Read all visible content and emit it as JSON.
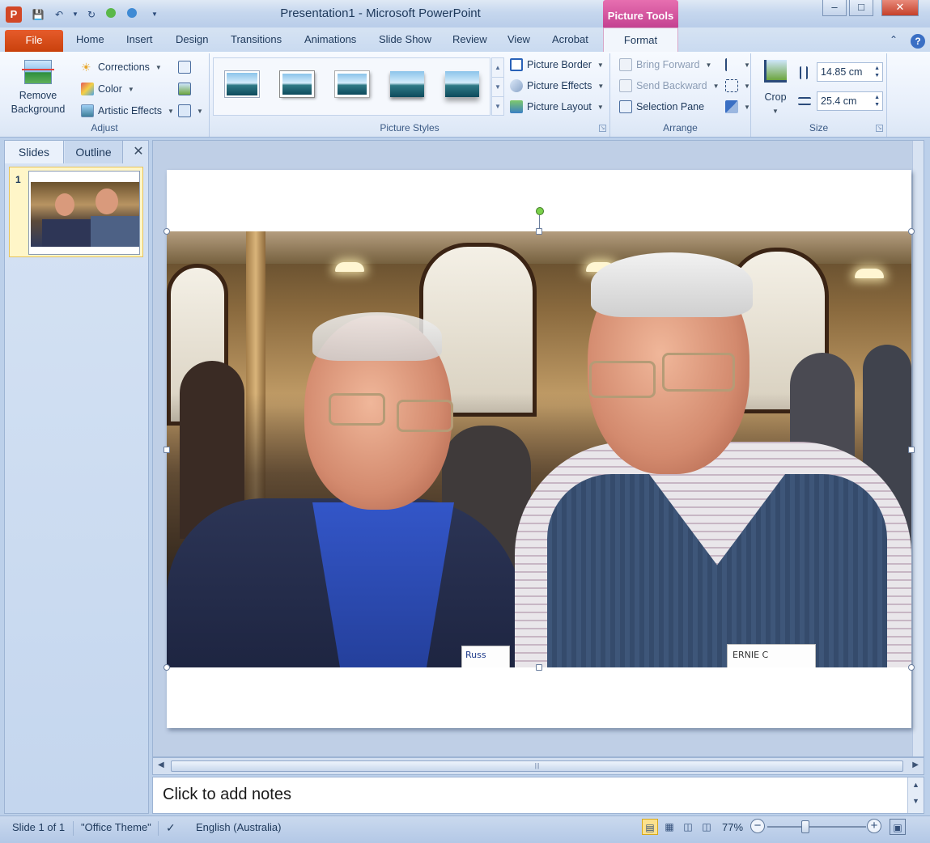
{
  "window": {
    "title": "Presentation1 - Microsoft PowerPoint",
    "contextual_tab": "Picture Tools",
    "app_icon": "P"
  },
  "quick_access": [
    "save-icon",
    "undo-icon",
    "redo-icon",
    "repeat-icon",
    "customize-icon"
  ],
  "tabs": {
    "file": "File",
    "items": [
      "Home",
      "Insert",
      "Design",
      "Transitions",
      "Animations",
      "Slide Show",
      "Review",
      "View",
      "Acrobat"
    ],
    "format": "Format"
  },
  "ribbon": {
    "adjust": {
      "label": "Adjust",
      "remove_background": "Remove Background",
      "corrections": "Corrections",
      "color": "Color",
      "artistic_effects": "Artistic Effects"
    },
    "picture_styles": {
      "label": "Picture Styles",
      "border": "Picture Border",
      "effects": "Picture Effects",
      "layout": "Picture Layout"
    },
    "arrange": {
      "label": "Arrange",
      "bring_forward": "Bring Forward",
      "send_backward": "Send Backward",
      "selection_pane": "Selection Pane"
    },
    "size": {
      "label": "Size",
      "crop": "Crop",
      "height": "14.85 cm",
      "width": "25.4 cm"
    }
  },
  "slides_pane": {
    "tab_slides": "Slides",
    "tab_outline": "Outline",
    "close": "✕",
    "slide_number": "1"
  },
  "photo": {
    "tag_left": "Russ",
    "tag_right": "ERNIE C"
  },
  "notes": {
    "placeholder": "Click to add notes"
  },
  "status": {
    "slide": "Slide 1 of 1",
    "theme": "\"Office Theme\"",
    "language": "English (Australia)",
    "zoom": "77%"
  },
  "colors": {
    "file_tab": "#d6501c",
    "picture_tools": "#c13d8e",
    "ribbon_text": "#1e395b"
  }
}
